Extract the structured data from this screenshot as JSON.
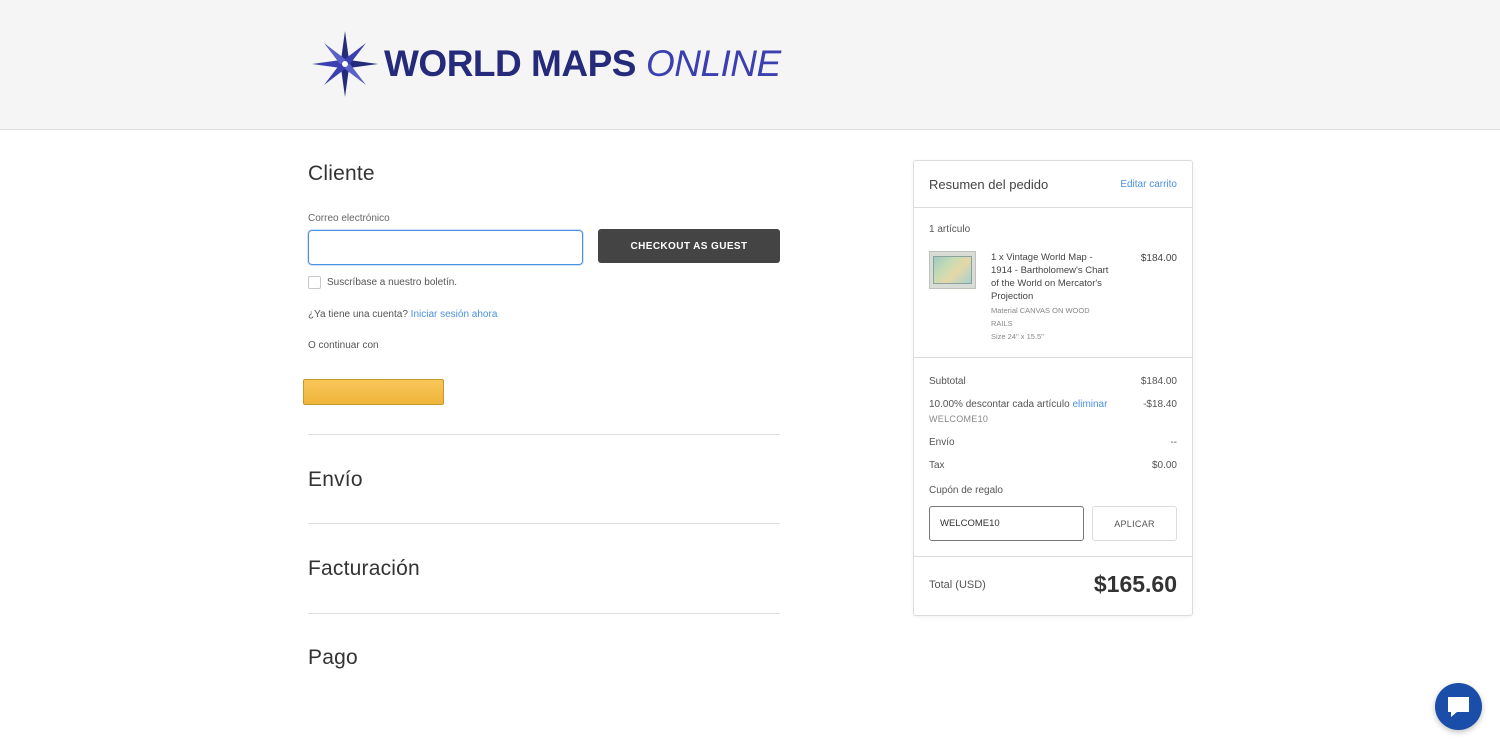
{
  "brand": {
    "name_part1": "WORLD MAPS",
    "name_part2": "ONLINE",
    "primary_color": "#252a7a",
    "accent_color": "#3b3fb0"
  },
  "customer": {
    "title": "Cliente",
    "email_label": "Correo electrónico",
    "email_value": "",
    "guest_button": "CHECKOUT AS GUEST",
    "newsletter_label": "Suscríbase a nuestro boletín.",
    "account_prompt": "¿Ya tiene una cuenta?",
    "login_link": "Iniciar sesión ahora",
    "continue_with": "O continuar con"
  },
  "sections": {
    "shipping": "Envío",
    "billing": "Facturación",
    "payment": "Pago"
  },
  "summary": {
    "title": "Resumen del pedido",
    "edit_cart": "Editar carrito",
    "item_count": "1 artículo",
    "items": [
      {
        "name": "1 x Vintage World Map - 1914 - Bartholomew's Chart of the World on Mercator's Projection",
        "price": "$184.00",
        "material": "Material CANVAS ON WOOD RAILS",
        "size": "Size 24\" x 15.5\""
      }
    ],
    "subtotal_label": "Subtotal",
    "subtotal_value": "$184.00",
    "discount_label": "10.00% descontar cada artículo",
    "discount_remove": "eliminar",
    "discount_value": "-$18.40",
    "discount_code": "WELCOME10",
    "shipping_label": "Envío",
    "shipping_value": "--",
    "tax_label": "Tax",
    "tax_value": "$0.00",
    "coupon_label": "Cupón de regalo",
    "coupon_value": "WELCOME10",
    "apply_button": "APLICAR",
    "total_label": "Total (USD)",
    "total_value": "$165.60"
  },
  "colors": {
    "link": "#4a90e2",
    "dark_button": "#444444",
    "paypal": "#f0b53a",
    "chat": "#1a4ea8"
  }
}
